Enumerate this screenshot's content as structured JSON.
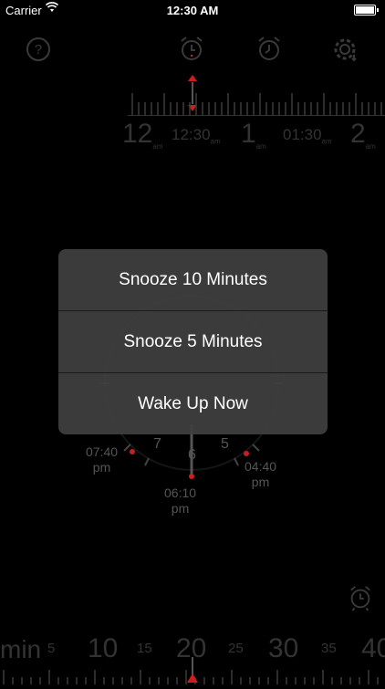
{
  "status_bar": {
    "carrier": "Carrier",
    "time": "12:30 AM"
  },
  "toolbar": {
    "icons": [
      "help-icon",
      "alarm-add-icon",
      "alarm-clock-icon",
      "settings-icon"
    ]
  },
  "timeline_top": {
    "labels": [
      {
        "text": "12",
        "sub": "am"
      },
      {
        "text": "12:30",
        "sub": "am"
      },
      {
        "text": "1",
        "sub": "am"
      },
      {
        "text": "01:30",
        "sub": "am"
      },
      {
        "text": "2",
        "sub": "am"
      }
    ]
  },
  "clock": {
    "numbers": [
      "7",
      "6",
      "5"
    ],
    "labels": [
      {
        "time": "07:40",
        "period": "pm"
      },
      {
        "time": "06:10",
        "period": "pm"
      },
      {
        "time": "04:40",
        "period": "pm"
      }
    ]
  },
  "action_sheet": {
    "items": [
      "Snooze 10 Minutes",
      "Snooze 5 Minutes",
      "Wake Up Now"
    ]
  },
  "timeline_bottom": {
    "unit": "min",
    "labels": [
      "5",
      "10",
      "15",
      "20",
      "25",
      "30",
      "35",
      "40"
    ]
  },
  "colors": {
    "accent": "#cc1e1e",
    "sheet": "#404040"
  }
}
